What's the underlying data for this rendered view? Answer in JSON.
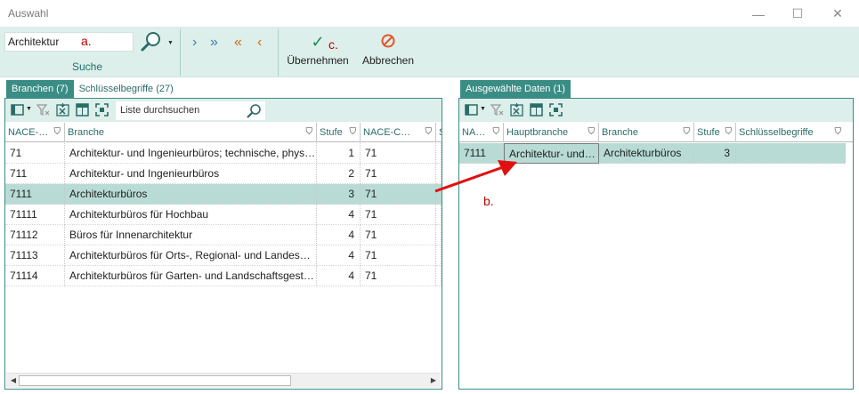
{
  "window": {
    "title": "Auswahl",
    "minimize": "—",
    "maximize": "☐",
    "close": "✕"
  },
  "ribbon": {
    "search_value": "Architektur",
    "annotation_a": "a.",
    "annotation_c": "c.",
    "search_group_label": "Suche",
    "add_one": "›",
    "add_all": "»",
    "remove_all": "«",
    "remove_one": "‹",
    "apply_label": "Übernehmen",
    "cancel_label": "Abbrechen",
    "accent": "#3a8d84",
    "ribbon_bg": "#ddefea"
  },
  "left": {
    "tabs": [
      "Branchen (7)",
      "Schlüsselbegriffe (27)"
    ],
    "search_placeholder": "Liste durchsuchen",
    "columns": [
      "NACE-…",
      "Branche",
      "Stufe",
      "NACE-C…",
      "S"
    ],
    "rows": [
      {
        "nace": "71",
        "branche": "Architektur- und Ingenieurbüros; technische, physik…",
        "stufe": "1",
        "nacec": "71"
      },
      {
        "nace": "711",
        "branche": "Architektur- und Ingenieurbüros",
        "stufe": "2",
        "nacec": "71"
      },
      {
        "nace": "7111",
        "branche": "Architekturbüros",
        "stufe": "3",
        "nacec": "71"
      },
      {
        "nace": "71111",
        "branche": "Architekturbüros für Hochbau",
        "stufe": "4",
        "nacec": "71"
      },
      {
        "nace": "71112",
        "branche": "Büros für Innenarchitektur",
        "stufe": "4",
        "nacec": "71"
      },
      {
        "nace": "71113",
        "branche": "Architekturbüros für Orts-, Regional- und Landespla…",
        "stufe": "4",
        "nacec": "71"
      },
      {
        "nace": "71114",
        "branche": "Architekturbüros für Garten- und Landschaftsgestalt…",
        "stufe": "4",
        "nacec": "71"
      }
    ],
    "selected_row": 2
  },
  "right": {
    "tab": "Ausgewählte Daten (1)",
    "columns": [
      "NA…",
      "Hauptbranche",
      "Branche",
      "Stufe",
      "Schlüsselbegriffe"
    ],
    "rows": [
      {
        "nace": "7111",
        "haupt": "Architektur- und I…",
        "branche": "Architekturbüros",
        "stufe": "3",
        "schluessel": ""
      }
    ]
  },
  "annotation_b": "b.",
  "annotation_color": "#c00000"
}
